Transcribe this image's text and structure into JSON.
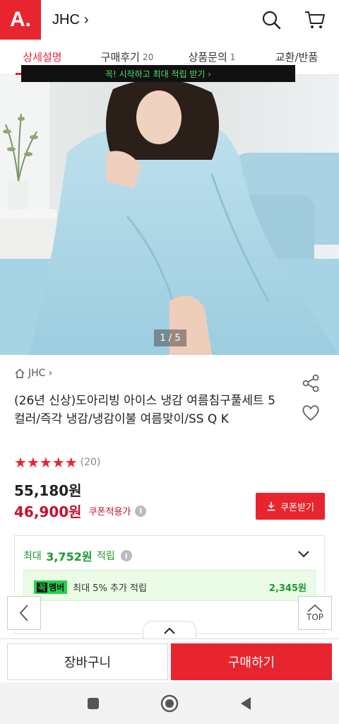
{
  "header": {
    "logo_text": "A.",
    "store_name": "JHC",
    "chevron": "›",
    "icons": [
      "search-icon",
      "cart-icon"
    ]
  },
  "tabs": [
    {
      "label": "상세설명",
      "count": ""
    },
    {
      "label": "구매후기",
      "count": "20"
    },
    {
      "label": "상품문의",
      "count": "1"
    },
    {
      "label": "교환/반품",
      "count": ""
    }
  ],
  "gallery": {
    "pager": "1 / 5"
  },
  "product": {
    "brand": "JHC",
    "brand_chevron": "›",
    "title": "(26년 신상)도아리빙 아이스 냉감 여름침구풀세트 5컬러/즉각 냉감/냉감이불 여름맞이/SS Q K",
    "stars": "★★★★★",
    "review_count": "(20)",
    "original_price": "55,180원",
    "sale_price": "46,900원",
    "coupon_applied": "쿠폰적용가",
    "info": "i",
    "coupon_button": "쿠폰받기"
  },
  "points": {
    "prefix": "최대",
    "amount": "3,752원",
    "suffix": "적립",
    "member_badge_a": "꼭",
    "member_badge_b": "멤버",
    "member_text": "최대 5% 추가 적립",
    "member_amount": "2,345원",
    "banner": "꼭! 시작하고 최대 적립 받기  ›"
  },
  "floating": {
    "top_label": "TOP"
  },
  "bottom": {
    "cart": "장바구니",
    "buy": "구매하기"
  },
  "colors": {
    "accent": "#e8252f",
    "sale": "#c8102e",
    "green": "#1c9b2f"
  }
}
